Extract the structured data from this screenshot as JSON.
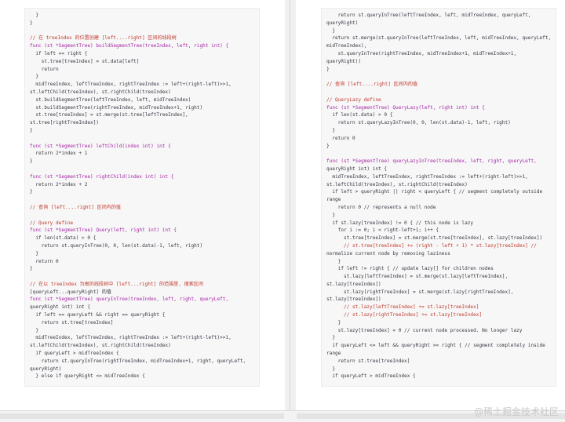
{
  "left_code": [
    "  }",
    "}",
    "",
    "// 在 treeIndex 的位置创建 [left....right] 区间的线段树",
    "func (st *SegmentTree) buildSegmentTree(treeIndex, left, right int) {",
    "  if left == right {",
    "    st.tree[treeIndex] = st.data[left]",
    "    return",
    "  }",
    "  midTreeIndex, leftTreeIndex, rightTreeIndex := left+(right-left)>>1,",
    "st.leftChild(treeIndex), st.rightChild(treeIndex)",
    "  st.buildSegmentTree(leftTreeIndex, left, midTreeIndex)",
    "  st.buildSegmentTree(rightTreeIndex, midTreeIndex+1, right)",
    "  st.tree[treeIndex] = st.merge(st.tree[leftTreeIndex],",
    "st.tree[rightTreeIndex])",
    "}",
    "",
    "func (st *SegmentTree) leftChild(index int) int {",
    "  return 2*index + 1",
    "}",
    "",
    "func (st *SegmentTree) rightChild(index int) int {",
    "  return 2*index + 2",
    "}",
    "",
    "// 查询 [left....right] 区间内的值",
    "",
    "// Query define",
    "func (st *SegmentTree) Query(left, right int) int {",
    "  if len(st.data) > 0 {",
    "    return st.queryInTree(0, 0, len(st.data)-1, left, right)",
    "  }",
    "  return 0",
    "}",
    "",
    "// 在以 treeIndex 为根的线段树中 [left...right] 的范围里, 搜索区间",
    "[queryLeft...queryRight] 的值",
    "func (st *SegmentTree) queryInTree(treeIndex, left, right, queryLeft,",
    "queryRight int) int {",
    "  if left == queryLeft && right == queryRight {",
    "    return st.tree[treeIndex]",
    "  }",
    "  midTreeIndex, leftTreeIndex, rightTreeIndex := left+(right-left)>>1,",
    "st.leftChild(treeIndex), st.rightChild(treeIndex)",
    "  if queryLeft > midTreeIndex {",
    "    return st.queryInTree(rightTreeIndex, midTreeIndex+1, right, queryLeft,",
    "queryRight)",
    "  } else if queryRight <= midTreeIndex {"
  ],
  "right_code": [
    "    return st.queryInTree(leftTreeIndex, left, midTreeIndex, queryLeft,",
    "queryRight)",
    "  }",
    "  return st.merge(st.queryInTree(leftTreeIndex, left, midTreeIndex, queryLeft,",
    "midTreeIndex),",
    "    st.queryInTree(rightTreeIndex, midTreeIndex+1, midTreeIndex+1,",
    "queryRight))",
    "}",
    "",
    "// 查询 [left....right] 区间内的值",
    "",
    "// QueryLazy define",
    "func (st *SegmentTree) QueryLazy(left, right int) int {",
    "  if len(st.data) > 0 {",
    "    return st.queryLazyInTree(0, 0, len(st.data)-1, left, right)",
    "  }",
    "  return 0",
    "}",
    "",
    "func (st *SegmentTree) queryLazyInTree(treeIndex, left, right, queryLeft,",
    "queryRight int) int {",
    "  midTreeIndex, leftTreeIndex, rightTreeIndex := left+(right-left)>>1,",
    "st.leftChild(treeIndex), st.rightChild(treeIndex)",
    "  if left > queryRight || right < queryLeft { // segment completely outside",
    "range",
    "    return 0 // represents a null node",
    "  }",
    "  if st.lazy[treeIndex] != 0 { // this node is lazy",
    "    for i := 0; i < right-left+1; i++ {",
    "      st.tree[treeIndex] = st.merge(st.tree[treeIndex], st.lazy[treeIndex])",
    "      // st.tree[treeIndex] += (right - left + 1) * st.lazy[treeIndex] //",
    "normalize current node by removing laziness",
    "    }",
    "    if left != right { // update lazy[] for children nodes",
    "      st.lazy[leftTreeIndex] = st.merge(st.lazy[leftTreeIndex],",
    "st.lazy[treeIndex])",
    "      st.lazy[rightTreeIndex] = st.merge(st.lazy[rightTreeIndex],",
    "st.lazy[treeIndex])",
    "      // st.lazy[leftTreeIndex] += st.lazy[treeIndex]",
    "      // st.lazy[rightTreeIndex] += st.lazy[treeIndex]",
    "    }",
    "    st.lazy[treeIndex] = 0 // current node processed. No longer lazy",
    "  }",
    "  if queryLeft <= left && queryRight >= right { // segment completely inside",
    "range",
    "    return st.tree[treeIndex]",
    "  }",
    "  if queryLeft > midTreeIndex {"
  ],
  "watermark": "@稀土掘金技术社区",
  "colors": {
    "comment": "#c0392b",
    "keyword": "#a626a4",
    "function": "#4078f2",
    "text": "#383a42",
    "code_bg": "#f7f7f8"
  }
}
